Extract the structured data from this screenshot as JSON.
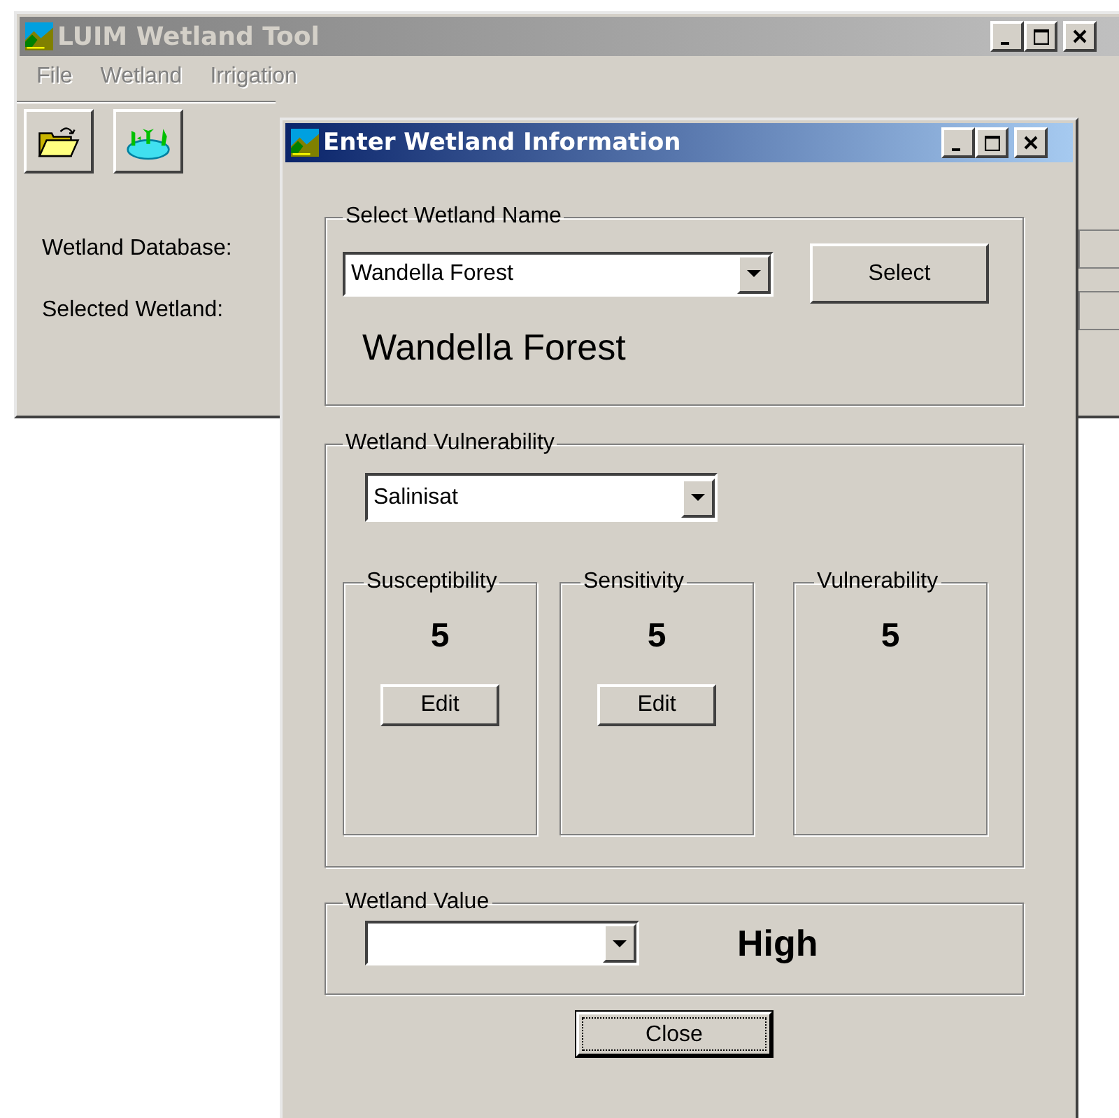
{
  "main_window": {
    "title": "LUIM Wetland Tool",
    "active": false,
    "menu": [
      {
        "label": "File",
        "disabled": true
      },
      {
        "label": "Wetland",
        "disabled": true
      },
      {
        "label": "Irrigation",
        "disabled": true
      }
    ],
    "labels": [
      "Wetland Database:",
      "Selected Wetland:"
    ]
  },
  "dialog": {
    "title": "Enter Wetland Information",
    "active": true,
    "name_group": {
      "legend": "Select Wetland Name",
      "combo_value": "Wandella Forest",
      "button": "Select",
      "selected_name": "Wandella Forest"
    },
    "vulnerability_group": {
      "legend": "Wetland Vulnerability",
      "combo_value": "Salinisat",
      "scores": [
        {
          "legend": "Susceptibility",
          "value": "5",
          "button": "Edit"
        },
        {
          "legend": "Sensitivity",
          "value": "5",
          "button": "Edit"
        },
        {
          "legend": "Vulnerability",
          "value": "5"
        }
      ]
    },
    "value_group": {
      "legend": "Wetland Value",
      "result": "High"
    },
    "close_button": {
      "label": "Close",
      "focused": true
    }
  }
}
